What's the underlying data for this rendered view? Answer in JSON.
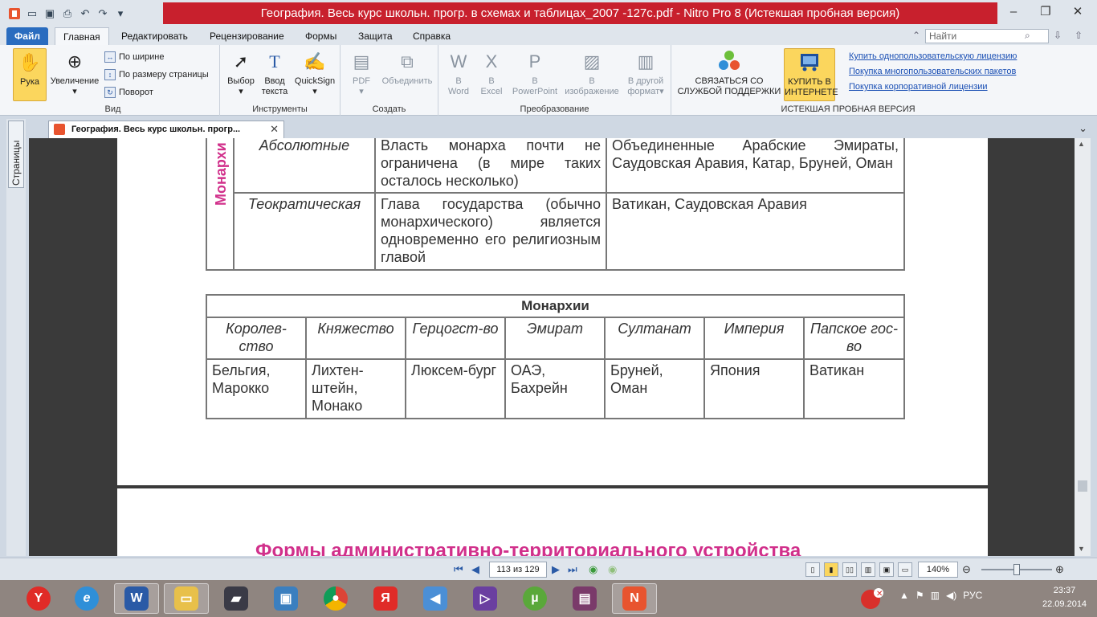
{
  "window": {
    "title": "География. Весь курс школьн. прогр. в схемах и таблицах_2007 -127с.pdf - Nitro Pro 8 (Истекшая пробная версия)"
  },
  "menu": {
    "tabs": [
      "Файл",
      "Главная",
      "Редактировать",
      "Рецензирование",
      "Формы",
      "Защита",
      "Справка"
    ],
    "search_placeholder": "Найти"
  },
  "ribbon": {
    "view": {
      "hand": "Рука",
      "zoom": "Увеличение",
      "fit_width": "По ширине",
      "fit_page": "По размеру страницы",
      "rotate": "Поворот",
      "label": "Вид"
    },
    "tools": {
      "select": "Выбор",
      "type_line1": "Ввод",
      "type_line2": "текста",
      "quicksign": "QuickSign",
      "label": "Инструменты"
    },
    "create": {
      "pdf": "PDF",
      "combine": "Объединить",
      "label": "Создать"
    },
    "convert": {
      "to_word_1": "В",
      "to_word_2": "Word",
      "to_excel_1": "В",
      "to_excel_2": "Excel",
      "to_ppt_1": "В",
      "to_ppt_2": "PowerPoint",
      "to_image_1": "В",
      "to_image_2": "изображение",
      "to_other_1": "В другой",
      "to_other_2": "формат",
      "label": "Преобразование"
    },
    "trial": {
      "contact_1": "СВЯЗАТЬСЯ СО",
      "contact_2": "СЛУЖБОЙ ПОДДЕРЖКИ",
      "buy_1": "КУПИТЬ В",
      "buy_2": "ИНТЕРНЕТЕ",
      "link1": "Купить однопользовательскую лицензию",
      "link2": "Покупка многопользовательских пакетов",
      "link3": "Покупка корпоративной лицензии",
      "label": "ИСТЕКШАЯ ПРОБНАЯ ВЕРСИЯ"
    }
  },
  "doc_tab": {
    "title": "География. Весь курс школьн. прогр..."
  },
  "left_pane": {
    "pages_label": "Страницы"
  },
  "document": {
    "table1": {
      "vertical_label": "Монархи",
      "rows": [
        {
          "type": "Абсолютные",
          "desc": "Власть монарха почти не ограничена (в мире таких осталось несколько)",
          "examples": "Объединенные Арабские Эмираты, Саудовская Аравия, Катар, Бруней, Оман"
        },
        {
          "type": "Теократическая",
          "desc": "Глава государства (обычно монархического) является одновременно его религиозным главой",
          "examples": "Ватикан, Саудовская Аравия"
        }
      ]
    },
    "table2": {
      "title": "Монархии",
      "headers": [
        "Королев-ство",
        "Княжество",
        "Герцогст-во",
        "Эмират",
        "Султанат",
        "Империя",
        "Папское гос-во"
      ],
      "values": [
        "Бельгия, Марокко",
        "Лихтен-штейн, Монако",
        "Люксем-бург",
        "ОАЭ, Бахрейн",
        "Бруней, Оман",
        "Япония",
        "Ватикан"
      ]
    },
    "next_heading": "Формы административно-территориального устройства"
  },
  "statusbar": {
    "page_indicator": "113 из 129",
    "zoom": "140%"
  },
  "taskbar": {
    "lang": "РУС",
    "time": "23:37",
    "date": "22.09.2014"
  }
}
